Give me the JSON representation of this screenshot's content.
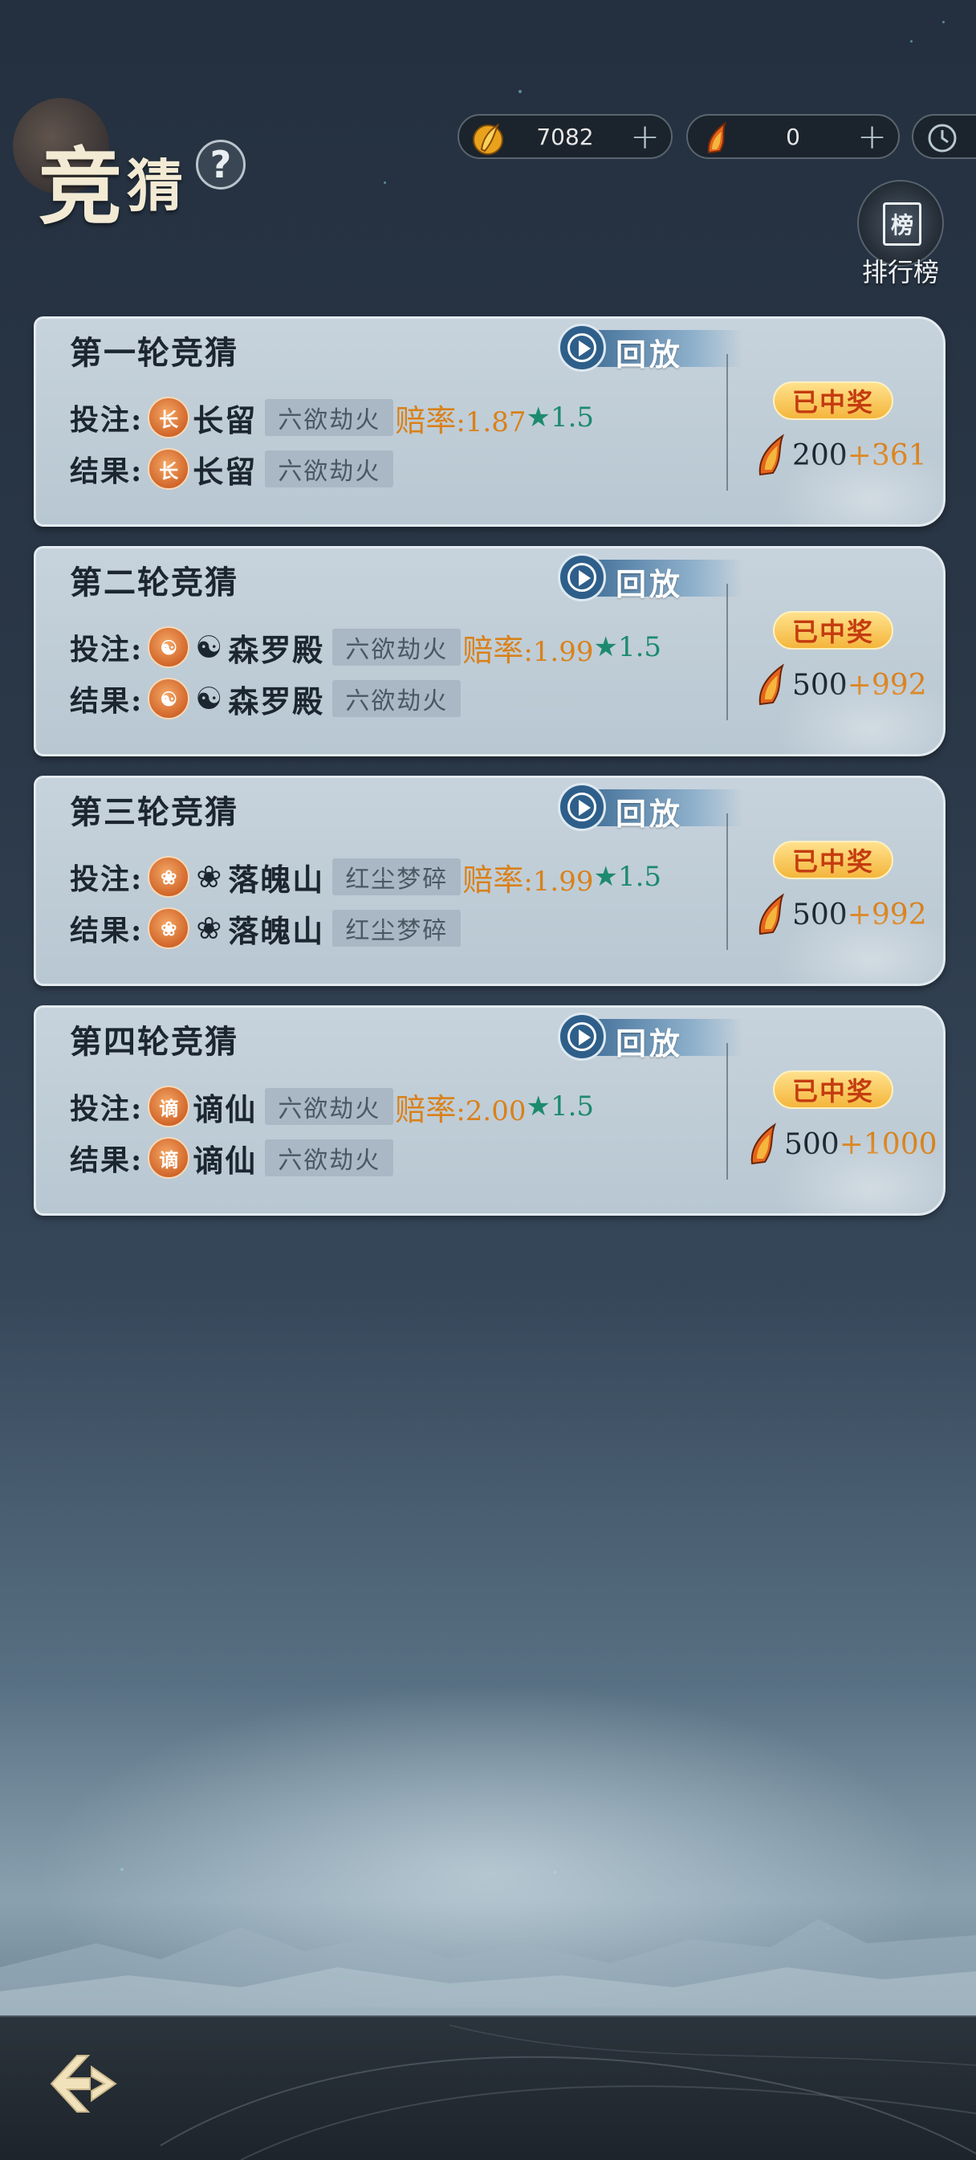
{
  "header": {
    "title_big": "竞",
    "title_small": "猜",
    "help_label": "?",
    "ranking_label": "排行榜",
    "ranking_icon_char": "榜"
  },
  "currencies": [
    {
      "icon": "gold-feather-coin-icon",
      "value": "7082",
      "plus": "+"
    },
    {
      "icon": "fire-feather-coin-icon",
      "value": "0",
      "plus": "+"
    }
  ],
  "labels": {
    "bet": "投注:",
    "result": "结果:",
    "odds": "赔率",
    "replay": "回放",
    "won": "已中奖"
  },
  "rounds": [
    {
      "title": "第一轮竞猜",
      "bet": {
        "badge": "长",
        "sect_icon": "",
        "sect": "长留",
        "tag": "六欲劫火",
        "odds": ":1.87",
        "mult": "★1.5"
      },
      "result": {
        "badge": "长",
        "sect_icon": "",
        "sect": "长留",
        "tag": "六欲劫火"
      },
      "status": "已中奖",
      "prize_base": "200",
      "prize_bonus": "+361"
    },
    {
      "title": "第二轮竞猜",
      "bet": {
        "badge": "☯",
        "sect_icon": "☯",
        "sect": "森罗殿",
        "tag": "六欲劫火",
        "odds": ":1.99",
        "mult": "★1.5"
      },
      "result": {
        "badge": "☯",
        "sect_icon": "☯",
        "sect": "森罗殿",
        "tag": "六欲劫火"
      },
      "status": "已中奖",
      "prize_base": "500",
      "prize_bonus": "+992"
    },
    {
      "title": "第三轮竞猜",
      "bet": {
        "badge": "❀",
        "sect_icon": "❀",
        "sect": "落魄山",
        "tag": "红尘梦碎",
        "odds": ":1.99",
        "mult": "★1.5"
      },
      "result": {
        "badge": "❀",
        "sect_icon": "❀",
        "sect": "落魄山",
        "tag": "红尘梦碎"
      },
      "status": "已中奖",
      "prize_base": "500",
      "prize_bonus": "+992"
    },
    {
      "title": "第四轮竞猜",
      "bet": {
        "badge": "谪",
        "sect_icon": "",
        "sect": "谪仙",
        "tag": "六欲劫火",
        "odds": ":2.00",
        "mult": "★1.5"
      },
      "result": {
        "badge": "谪",
        "sect_icon": "",
        "sect": "谪仙",
        "tag": "六欲劫火"
      },
      "status": "已中奖",
      "prize_base": "500",
      "prize_bonus": "+1000"
    }
  ],
  "colors": {
    "odds": "#d9811a",
    "multiplier": "#1d8a6e",
    "won_badge_text": "#c43c10",
    "card_bg": "#c7d3dc"
  }
}
